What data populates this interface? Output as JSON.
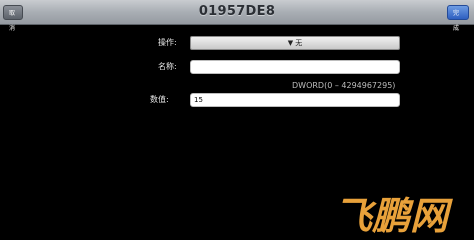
{
  "navbar": {
    "title": "01957DE8",
    "cancel_label": "取消",
    "done_label": "完成"
  },
  "form": {
    "operation": {
      "label": "操作:",
      "value": "▼ 无"
    },
    "name": {
      "label": "名称:",
      "value": ""
    },
    "type_hint": "DWORD(0 – 4294967295)",
    "numeric": {
      "label": "数值:",
      "value": "15"
    }
  },
  "watermark": {
    "text": "飞鹏网",
    "color": "#e8a13a"
  }
}
